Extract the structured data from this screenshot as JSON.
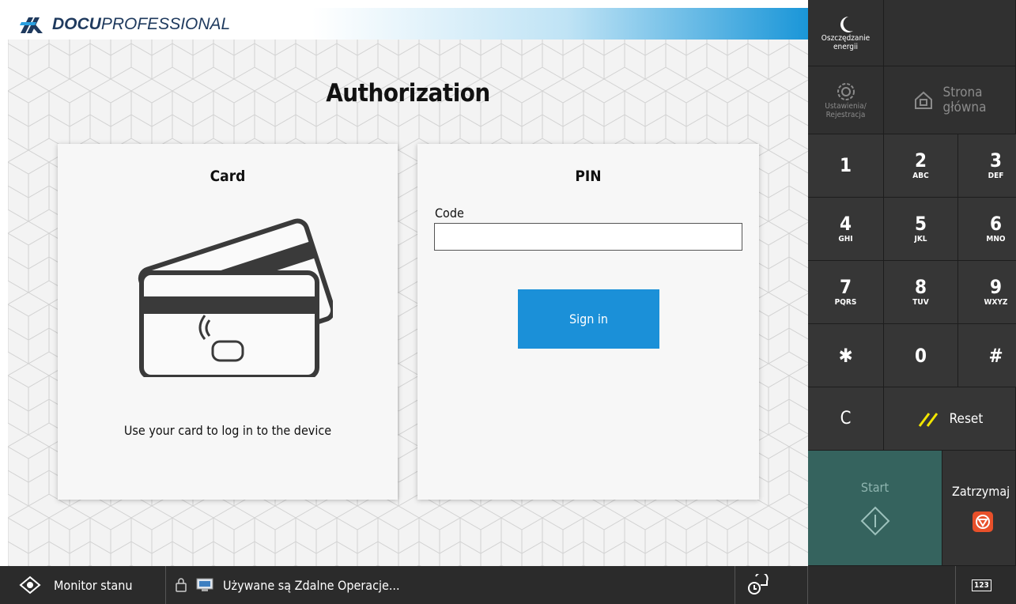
{
  "brand": {
    "bold": "DOCU",
    "light": "PROFESSIONAL"
  },
  "page": {
    "title": "Authorization"
  },
  "card_panel": {
    "title": "Card",
    "description": "Use your card to log in to the device"
  },
  "pin_panel": {
    "title": "PIN",
    "code_label": "Code",
    "code_value": "",
    "sign_in_label": "Sign in"
  },
  "side": {
    "energy_label_1": "Oszczędzanie",
    "energy_label_2": "energii",
    "settings_label_1": "Ustawienia/",
    "settings_label_2": "Rejestracja",
    "home_label_1": "Strona",
    "home_label_2": "główna",
    "keys": [
      {
        "num": "1",
        "sub": ""
      },
      {
        "num": "2",
        "sub": "ABC"
      },
      {
        "num": "3",
        "sub": "DEF"
      },
      {
        "num": "4",
        "sub": "GHI"
      },
      {
        "num": "5",
        "sub": "JKL"
      },
      {
        "num": "6",
        "sub": "MNO"
      },
      {
        "num": "7",
        "sub": "PQRS"
      },
      {
        "num": "8",
        "sub": "TUV"
      },
      {
        "num": "9",
        "sub": "WXYZ"
      },
      {
        "num": "✱",
        "sub": ""
      },
      {
        "num": "0",
        "sub": ""
      },
      {
        "num": "#",
        "sub": ""
      }
    ],
    "clear_label": "C",
    "reset_label": "Reset",
    "start_label": "Start",
    "stop_label": "Zatrzymaj"
  },
  "status": {
    "monitor_label": "Monitor stanu",
    "remote_text": "Używane są Zdalne Operacje...",
    "keypad_badge": "123"
  },
  "colors": {
    "accent": "#1b90d8",
    "start": "#35635e",
    "stop": "#e8502a",
    "reset_slash": "#f2e600"
  }
}
